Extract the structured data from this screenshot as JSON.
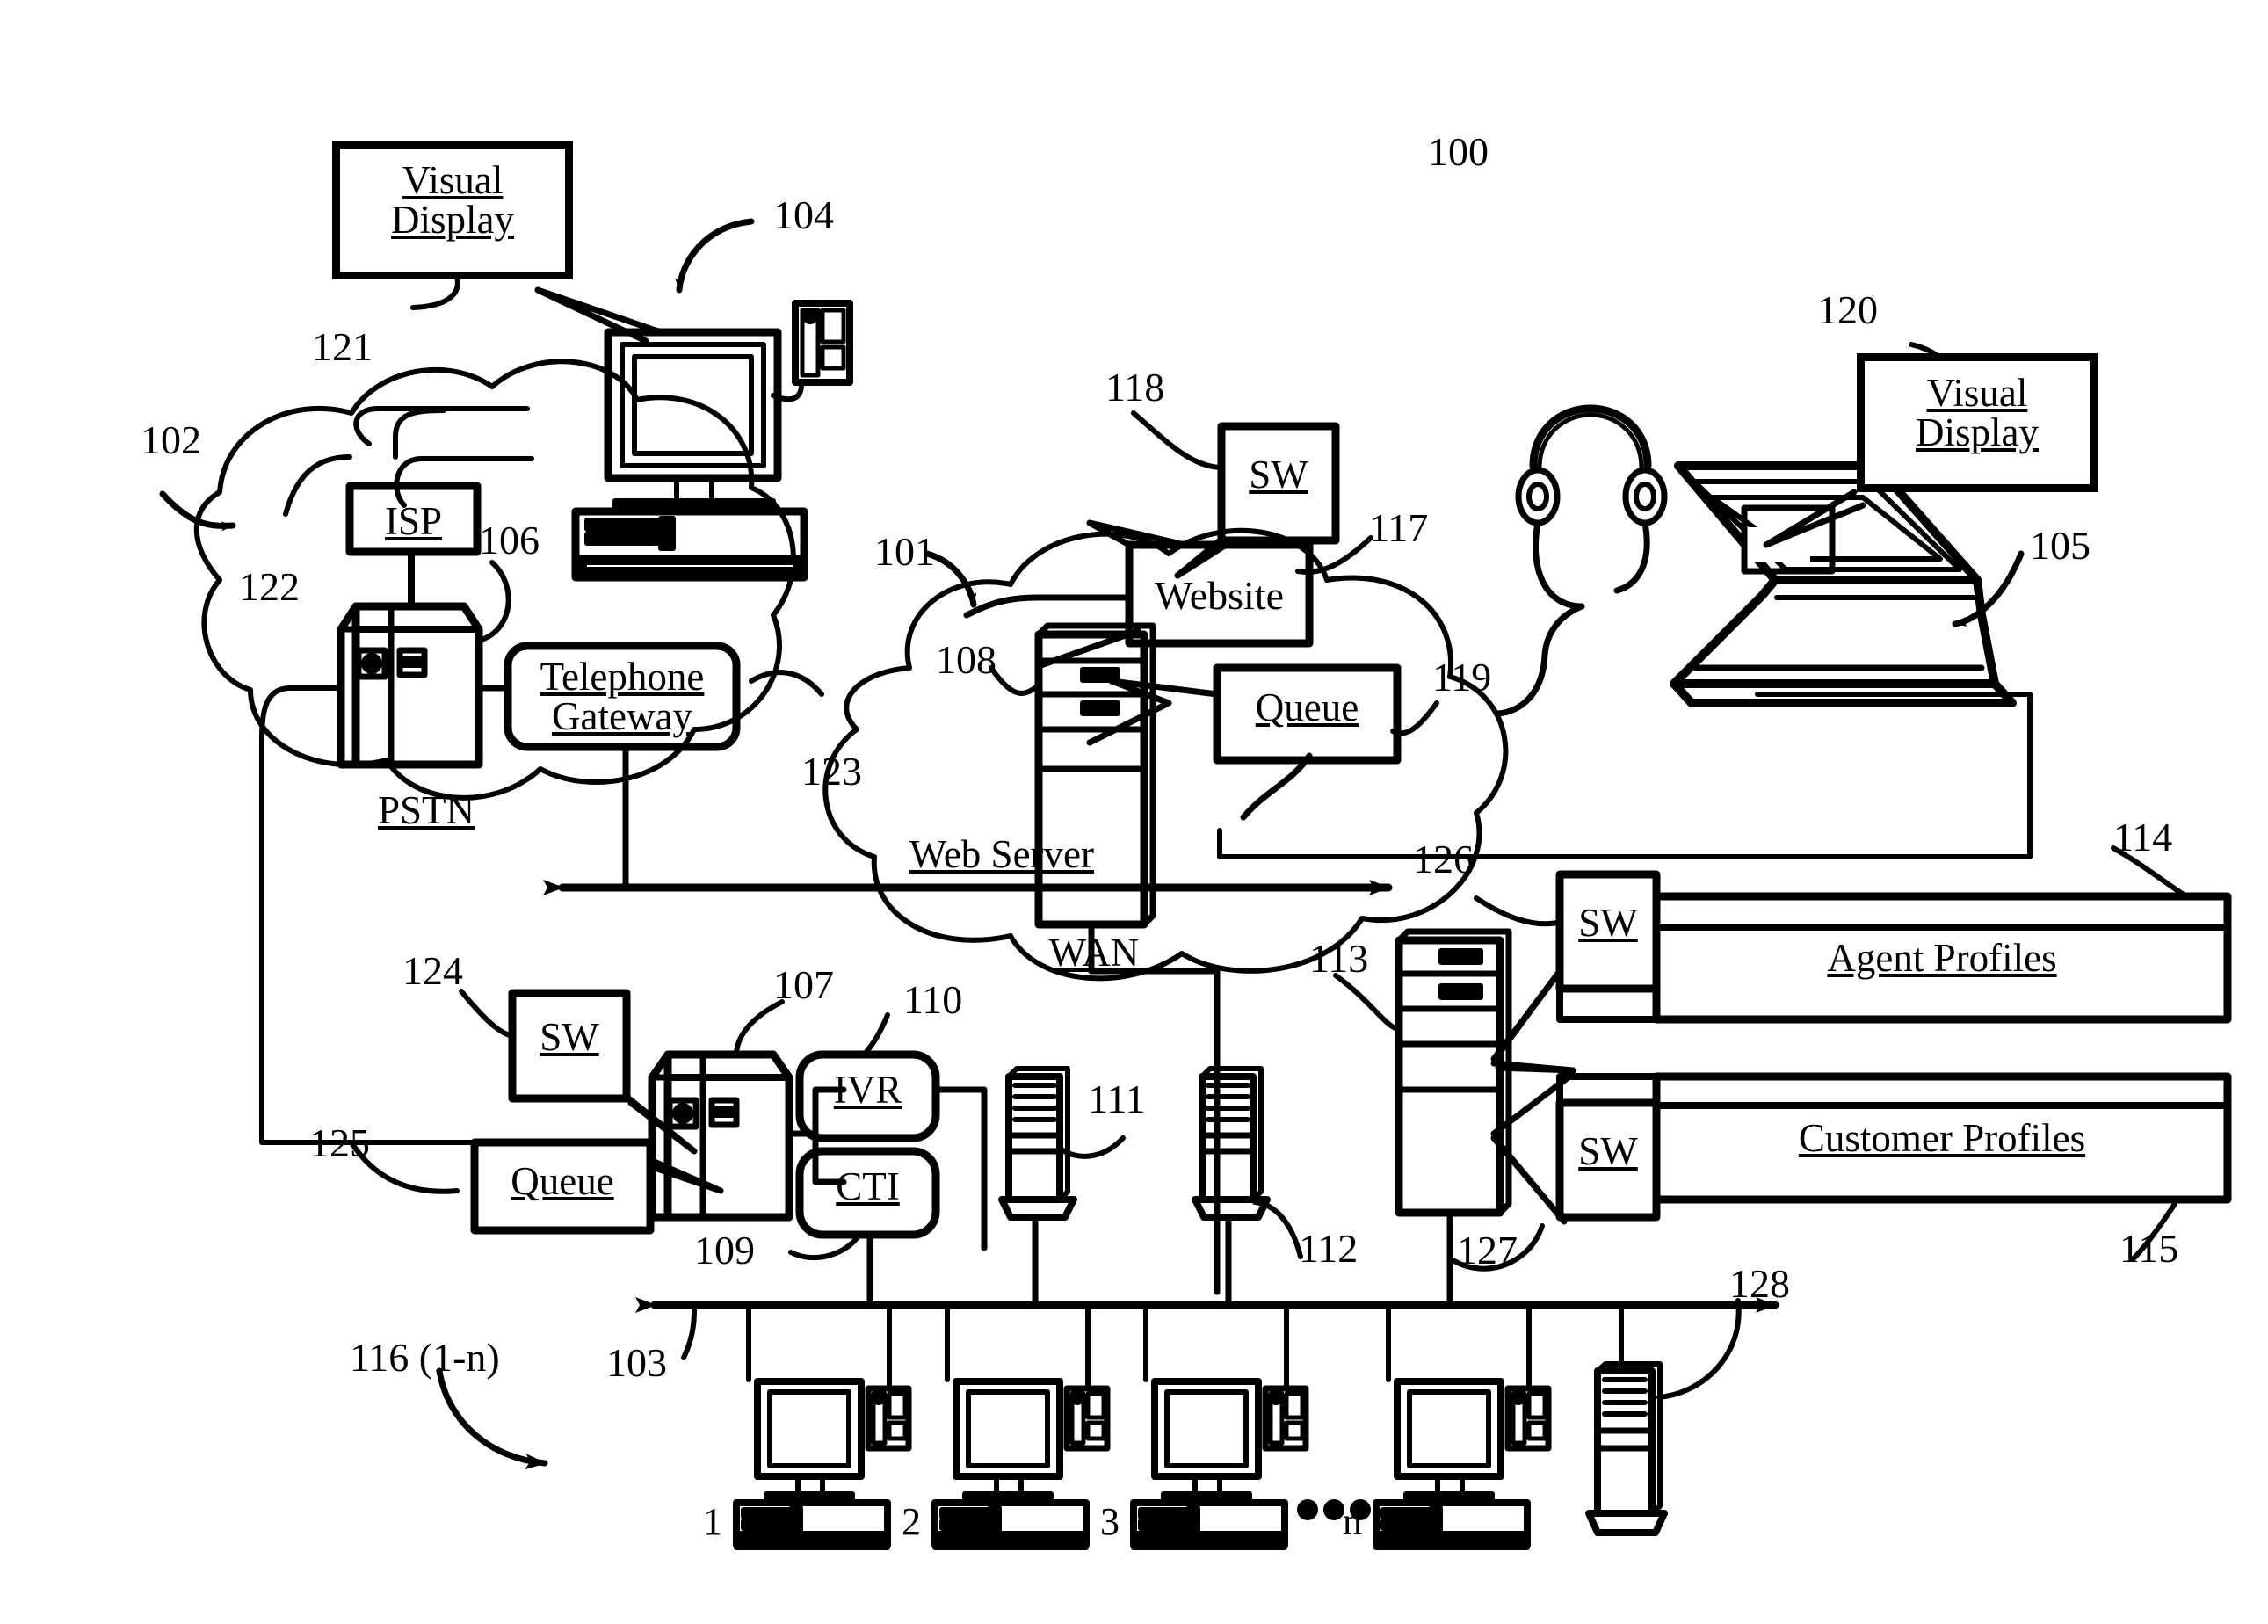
{
  "figure": {
    "type": "patent-system-diagram",
    "title_ref": "100",
    "description": "Call center system block diagram with PSTN, WAN, web server, agent workstations and profile databases"
  },
  "reference_numerals": {
    "system": "100",
    "wan": "101",
    "pstn": "102",
    "lan_bus": "103",
    "customer_computer": "104",
    "agent_laptop": "105",
    "pstn_switch": "106",
    "call_center_switch": "107",
    "web_server": "108",
    "cti": "109",
    "ivr": "110",
    "server_111": "111",
    "server_112": "112",
    "profile_server": "113",
    "agent_profiles_db": "114",
    "customer_profiles_db": "115",
    "agent_workstations": "116 (1-n)",
    "website": "117",
    "website_sw": "118",
    "web_queue": "119",
    "agent_visual_display": "120",
    "customer_visual_display": "121",
    "isp": "122",
    "telephone_gateway": "123",
    "switch_sw_124": "124",
    "call_center_queue": "125",
    "sw_126": "126",
    "sw_127": "127",
    "tower_128": "128"
  },
  "nodes": {
    "visual_display_customer": {
      "line1": "Visual",
      "line2": "Display"
    },
    "visual_display_agent": {
      "line1": "Visual",
      "line2": "Display"
    },
    "isp": "ISP",
    "telephone_gateway": {
      "line1": "Telephone",
      "line2": "Gateway"
    },
    "pstn": "PSTN",
    "wan": "WAN",
    "website": "Website",
    "website_sw": "SW",
    "web_queue": "Queue",
    "web_server": "Web Server",
    "call_center_sw": "SW",
    "call_center_queue": "Queue",
    "ivr": "IVR",
    "cti": "CTI",
    "agent_profiles": "Agent Profiles",
    "customer_profiles": "Customer Profiles",
    "sw_agent_profiles": "SW",
    "sw_customer_profiles": "SW"
  },
  "workstation_labels": [
    "1",
    "2",
    "3",
    "n"
  ],
  "ellipsis": "• • •",
  "colors": {
    "ink": "#000000",
    "paper": "#ffffff"
  }
}
